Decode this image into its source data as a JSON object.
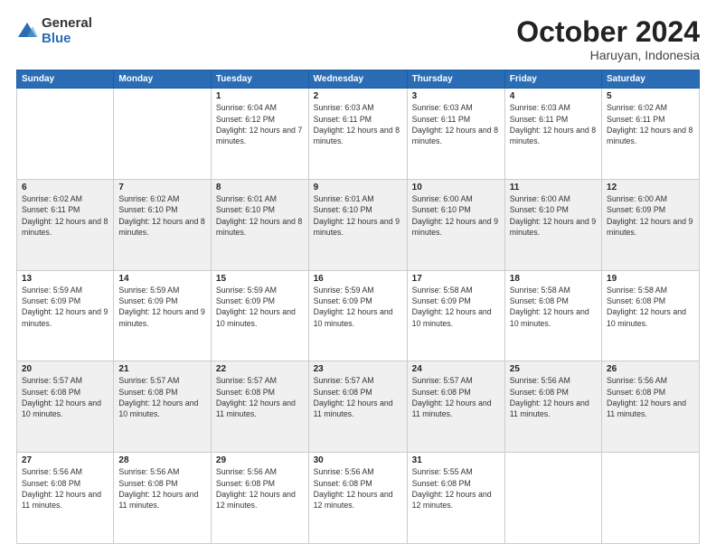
{
  "logo": {
    "general": "General",
    "blue": "Blue"
  },
  "header": {
    "month": "October 2024",
    "location": "Haruyan, Indonesia"
  },
  "weekdays": [
    "Sunday",
    "Monday",
    "Tuesday",
    "Wednesday",
    "Thursday",
    "Friday",
    "Saturday"
  ],
  "weeks": [
    [
      {
        "day": "",
        "info": ""
      },
      {
        "day": "",
        "info": ""
      },
      {
        "day": "1",
        "info": "Sunrise: 6:04 AM\nSunset: 6:12 PM\nDaylight: 12 hours and 7 minutes."
      },
      {
        "day": "2",
        "info": "Sunrise: 6:03 AM\nSunset: 6:11 PM\nDaylight: 12 hours and 8 minutes."
      },
      {
        "day": "3",
        "info": "Sunrise: 6:03 AM\nSunset: 6:11 PM\nDaylight: 12 hours and 8 minutes."
      },
      {
        "day": "4",
        "info": "Sunrise: 6:03 AM\nSunset: 6:11 PM\nDaylight: 12 hours and 8 minutes."
      },
      {
        "day": "5",
        "info": "Sunrise: 6:02 AM\nSunset: 6:11 PM\nDaylight: 12 hours and 8 minutes."
      }
    ],
    [
      {
        "day": "6",
        "info": "Sunrise: 6:02 AM\nSunset: 6:11 PM\nDaylight: 12 hours and 8 minutes."
      },
      {
        "day": "7",
        "info": "Sunrise: 6:02 AM\nSunset: 6:10 PM\nDaylight: 12 hours and 8 minutes."
      },
      {
        "day": "8",
        "info": "Sunrise: 6:01 AM\nSunset: 6:10 PM\nDaylight: 12 hours and 8 minutes."
      },
      {
        "day": "9",
        "info": "Sunrise: 6:01 AM\nSunset: 6:10 PM\nDaylight: 12 hours and 9 minutes."
      },
      {
        "day": "10",
        "info": "Sunrise: 6:00 AM\nSunset: 6:10 PM\nDaylight: 12 hours and 9 minutes."
      },
      {
        "day": "11",
        "info": "Sunrise: 6:00 AM\nSunset: 6:10 PM\nDaylight: 12 hours and 9 minutes."
      },
      {
        "day": "12",
        "info": "Sunrise: 6:00 AM\nSunset: 6:09 PM\nDaylight: 12 hours and 9 minutes."
      }
    ],
    [
      {
        "day": "13",
        "info": "Sunrise: 5:59 AM\nSunset: 6:09 PM\nDaylight: 12 hours and 9 minutes."
      },
      {
        "day": "14",
        "info": "Sunrise: 5:59 AM\nSunset: 6:09 PM\nDaylight: 12 hours and 9 minutes."
      },
      {
        "day": "15",
        "info": "Sunrise: 5:59 AM\nSunset: 6:09 PM\nDaylight: 12 hours and 10 minutes."
      },
      {
        "day": "16",
        "info": "Sunrise: 5:59 AM\nSunset: 6:09 PM\nDaylight: 12 hours and 10 minutes."
      },
      {
        "day": "17",
        "info": "Sunrise: 5:58 AM\nSunset: 6:09 PM\nDaylight: 12 hours and 10 minutes."
      },
      {
        "day": "18",
        "info": "Sunrise: 5:58 AM\nSunset: 6:08 PM\nDaylight: 12 hours and 10 minutes."
      },
      {
        "day": "19",
        "info": "Sunrise: 5:58 AM\nSunset: 6:08 PM\nDaylight: 12 hours and 10 minutes."
      }
    ],
    [
      {
        "day": "20",
        "info": "Sunrise: 5:57 AM\nSunset: 6:08 PM\nDaylight: 12 hours and 10 minutes."
      },
      {
        "day": "21",
        "info": "Sunrise: 5:57 AM\nSunset: 6:08 PM\nDaylight: 12 hours and 10 minutes."
      },
      {
        "day": "22",
        "info": "Sunrise: 5:57 AM\nSunset: 6:08 PM\nDaylight: 12 hours and 11 minutes."
      },
      {
        "day": "23",
        "info": "Sunrise: 5:57 AM\nSunset: 6:08 PM\nDaylight: 12 hours and 11 minutes."
      },
      {
        "day": "24",
        "info": "Sunrise: 5:57 AM\nSunset: 6:08 PM\nDaylight: 12 hours and 11 minutes."
      },
      {
        "day": "25",
        "info": "Sunrise: 5:56 AM\nSunset: 6:08 PM\nDaylight: 12 hours and 11 minutes."
      },
      {
        "day": "26",
        "info": "Sunrise: 5:56 AM\nSunset: 6:08 PM\nDaylight: 12 hours and 11 minutes."
      }
    ],
    [
      {
        "day": "27",
        "info": "Sunrise: 5:56 AM\nSunset: 6:08 PM\nDaylight: 12 hours and 11 minutes."
      },
      {
        "day": "28",
        "info": "Sunrise: 5:56 AM\nSunset: 6:08 PM\nDaylight: 12 hours and 11 minutes."
      },
      {
        "day": "29",
        "info": "Sunrise: 5:56 AM\nSunset: 6:08 PM\nDaylight: 12 hours and 12 minutes."
      },
      {
        "day": "30",
        "info": "Sunrise: 5:56 AM\nSunset: 6:08 PM\nDaylight: 12 hours and 12 minutes."
      },
      {
        "day": "31",
        "info": "Sunrise: 5:55 AM\nSunset: 6:08 PM\nDaylight: 12 hours and 12 minutes."
      },
      {
        "day": "",
        "info": ""
      },
      {
        "day": "",
        "info": ""
      }
    ]
  ]
}
